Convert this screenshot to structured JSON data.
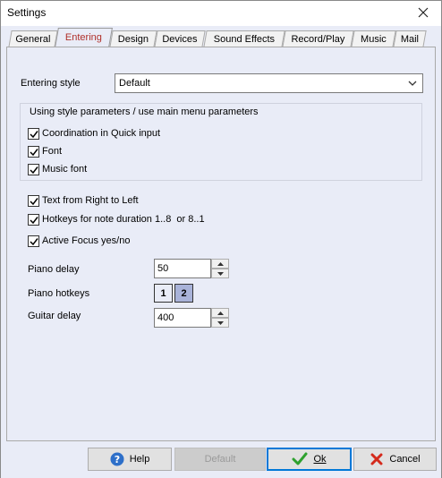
{
  "window": {
    "title": "Settings"
  },
  "tabs": [
    {
      "label": "General"
    },
    {
      "label": "Entering"
    },
    {
      "label": "Design"
    },
    {
      "label": "Devices"
    },
    {
      "label": "Sound Effects"
    },
    {
      "label": "Record/Play"
    },
    {
      "label": "Music"
    },
    {
      "label": "Mail"
    }
  ],
  "active_tab": "Entering",
  "entering": {
    "style_label": "Entering style",
    "style_value": "Default",
    "group_caption": "Using style parameters / use main menu parameters",
    "group_checks": [
      {
        "label": "Coordination in Quick input",
        "checked": true
      },
      {
        "label": "Font",
        "checked": true
      },
      {
        "label": "Music font",
        "checked": true
      }
    ],
    "checks": [
      {
        "label": "Text from Right to Left",
        "checked": true
      },
      {
        "label": "Hotkeys for note duration 1..8  or 8..1",
        "checked": true
      },
      {
        "label": "Active Focus yes/no",
        "checked": true
      }
    ],
    "piano_delay_label": "Piano delay",
    "piano_delay_value": "50",
    "piano_hotkeys_label": "Piano hotkeys",
    "piano_keys": [
      "1",
      "2"
    ],
    "piano_key_selected": "2",
    "guitar_delay_label": "Guitar delay",
    "guitar_delay_value": "400"
  },
  "buttons": {
    "help": "Help",
    "default": "Default",
    "ok": "Ok",
    "cancel": "Cancel"
  },
  "colors": {
    "panel_bg": "#e9ecf7",
    "active_tab_text": "#b0302a",
    "selected_key": "#a9b3d9",
    "focus_border": "#0078d7"
  }
}
